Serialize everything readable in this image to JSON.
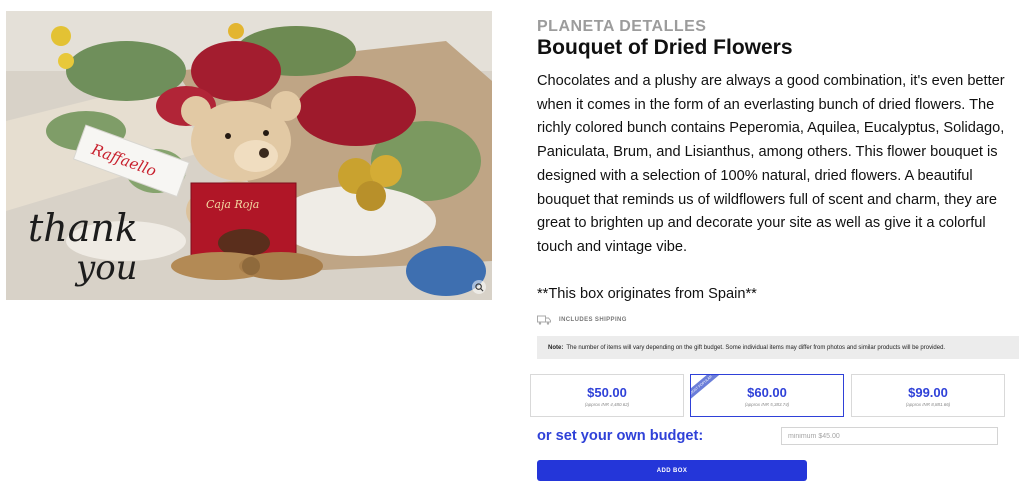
{
  "product": {
    "image_alt": "Bouquet of Dried Flowers",
    "photo_text": {
      "raffaello": "Raffaello",
      "box": "Caja Roja",
      "thank": "thank",
      "you": "you"
    },
    "brand": "PLANETA DETALLES",
    "title": "Bouquet of Dried Flowers",
    "description": "Chocolates and a plushy are always a good combination, it's even better when it comes in the form of an everlasting bunch of dried flowers. The richly colored bunch contains Peperomia, Aquilea, Eucalyptus, Solidago, Paniculata, Brum, and Lisianthus, among others. This flower bouquet is designed with a selection of 100% natural, dried flowers. A beautiful bouquet that reminds us of wildflowers full of scent and charm, they are great to brighten up and decorate your site as well as give it a colorful touch and vintage vibe.",
    "origin": "**This box originates from Spain**"
  },
  "shipping": {
    "icon": "truck-icon",
    "label": "INCLUDES SHIPPING"
  },
  "note": {
    "label": "Note:",
    "text": "The number of items will vary depending on the gift budget. Some individual items may differ from photos and similar products will be provided."
  },
  "options": [
    {
      "price": "$50.00",
      "approx": "(approx INR 4,480.62)",
      "selected": false
    },
    {
      "price": "$60.00",
      "approx": "(approx INR 5,383.74)",
      "selected": true,
      "badge": "MOST POPULAR"
    },
    {
      "price": "$99.00",
      "approx": "(approx INR 8,881.66)",
      "selected": false
    }
  ],
  "budget": {
    "label": "or set your own budget:",
    "placeholder": "minimum $45.00",
    "value": ""
  },
  "add_button": {
    "label": "ADD BOX"
  },
  "colors": {
    "accent": "#2f41d8",
    "button": "#2436d9",
    "brand_gray": "#9c9c9c"
  }
}
